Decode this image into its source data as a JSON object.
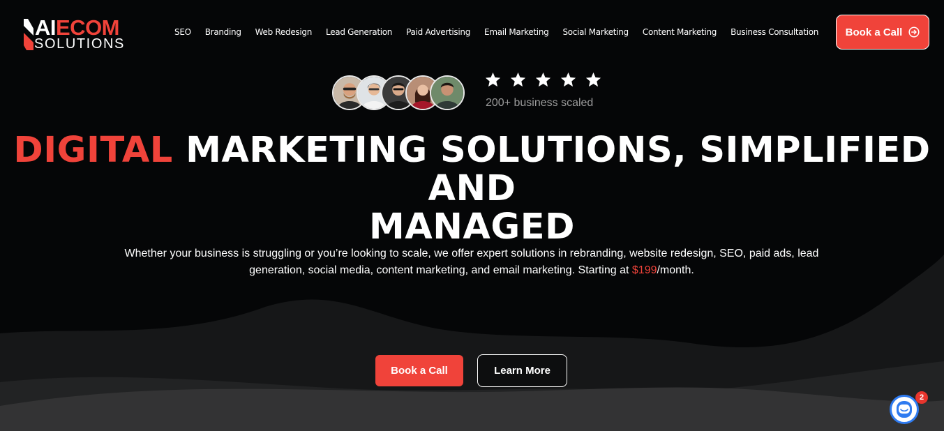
{
  "brand": {
    "logo_top_left": "AI",
    "logo_top_right": "ECOM",
    "logo_bottom": "SOLUTIONS",
    "accent_color": "#f0433a"
  },
  "nav": {
    "items": [
      {
        "label": "SEO"
      },
      {
        "label": "Branding"
      },
      {
        "label": "Web Redesign"
      },
      {
        "label": "Lead Generation"
      },
      {
        "label": "Paid Advertising"
      },
      {
        "label": "Email Marketing"
      },
      {
        "label": "Social Marketing"
      },
      {
        "label": "Content Marketing"
      },
      {
        "label": "Business Consultation"
      }
    ],
    "cta_label": "Book a Call",
    "cta_icon": "arrow-circle-right-icon"
  },
  "social_proof": {
    "avatar_count": 5,
    "star_count": 5,
    "rating_text": "200+ business scaled"
  },
  "hero": {
    "headline_accent": "DIGITAL",
    "headline_line1_rest": " MARKETING SOLUTIONS, SIMPLIFIED AND",
    "headline_line2": "MANAGED",
    "subtext_before_price": "Whether your business is struggling or you’re looking to scale, we offer expert solutions in rebranding, website redesign, SEO, paid ads, lead generation, social media, content marketing, and email marketing. Starting at ",
    "price": "$199",
    "subtext_after_price": "/month.",
    "primary_button": "Book a Call",
    "secondary_button": "Learn More"
  },
  "chat_widget": {
    "icon": "chat-icon",
    "badge_count": "2",
    "ring_color": "#2f7bf0"
  }
}
